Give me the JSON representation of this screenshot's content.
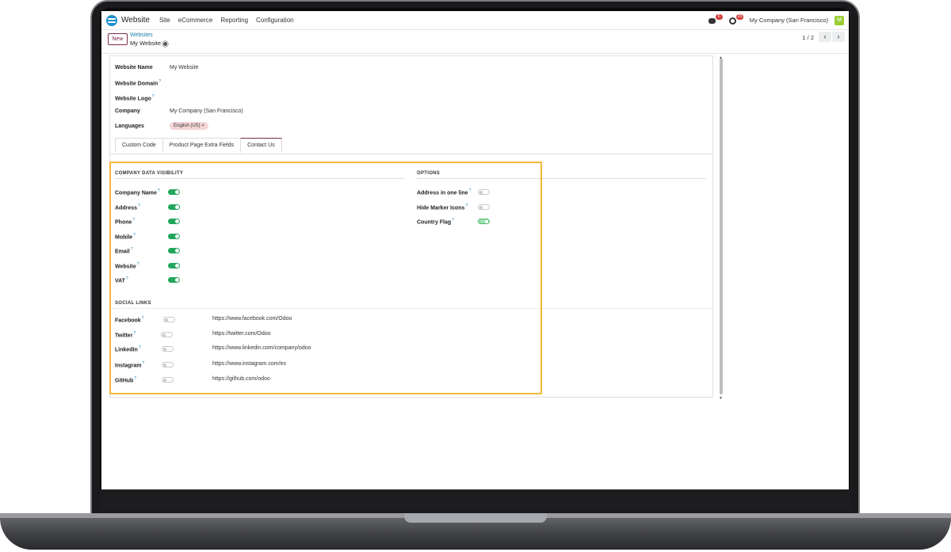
{
  "navbar": {
    "app_name": "Website",
    "menu": [
      "Site",
      "eCommerce",
      "Reporting",
      "Configuration"
    ],
    "messages_badge": "6",
    "activities_badge": "29",
    "company": "My Company (San Francisco)",
    "avatar_letter": "M"
  },
  "control_panel": {
    "new_label": "New",
    "breadcrumb": "Websites",
    "record_title": "My Website",
    "pager": "1 / 2",
    "prev": "‹",
    "next": "›"
  },
  "form": {
    "website_name_label": "Website Name",
    "website_name": "My Website",
    "website_domain_label": "Website Domain",
    "website_logo_label": "Website Logo",
    "company_label": "Company",
    "company": "My Company (San Francisco)",
    "languages_label": "Languages",
    "language_tag": "English (US) ×",
    "help_mark": "?"
  },
  "tabs": [
    "Custom Code",
    "Product Page Extra Fields",
    "Contact Us"
  ],
  "contact": {
    "company_data_title": "COMPANY DATA VISIBILITY",
    "options_title": "OPTIONS",
    "social_title": "SOCIAL LINKS",
    "company_data": [
      {
        "label": "Company Name",
        "state": "on"
      },
      {
        "label": "Address",
        "state": "on"
      },
      {
        "label": "Phone",
        "state": "on"
      },
      {
        "label": "Mobile",
        "state": "on"
      },
      {
        "label": "Email",
        "state": "on"
      },
      {
        "label": "Website",
        "state": "on"
      },
      {
        "label": "VAT",
        "state": "on"
      }
    ],
    "options": [
      {
        "label": "Address in one line",
        "state": "off"
      },
      {
        "label": "Hide Marker Icons",
        "state": "off"
      },
      {
        "label": "Country Flag",
        "state": "on"
      }
    ],
    "social": [
      {
        "label": "Facebook",
        "url": "https://www.facebook.com/Odoo",
        "state": "off"
      },
      {
        "label": "Twitter",
        "url": "https://twitter.com/Odoo",
        "state": "off"
      },
      {
        "label": "LinkedIn",
        "url": "https://www.linkedin.com/company/odoo",
        "state": "off"
      },
      {
        "label": "Instagram",
        "url": "https://www.instagram.com/ex",
        "state": "off"
      },
      {
        "label": "GitHub",
        "url": "https://github.com/odoo",
        "state": "off"
      }
    ]
  },
  "colors": {
    "toggle_on": "#21a65b",
    "highlight": "#f5b73b",
    "primary": "#7c2a4d",
    "link": "#1f7fb0"
  }
}
